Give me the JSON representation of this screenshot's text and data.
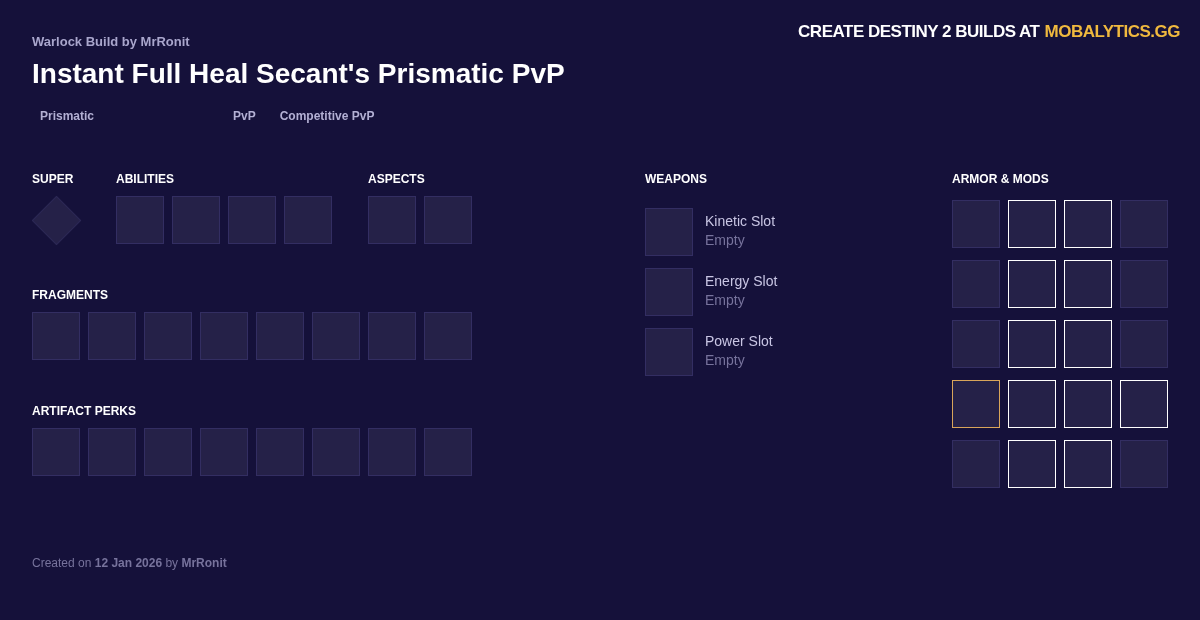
{
  "header": {
    "byline": "Warlock Build by **MrRonit**",
    "title": "Instant Full Heal Secant's Prismatic PvP"
  },
  "banner": {
    "text": "CREATE DESTINY 2 BUILDS AT",
    "link": "MOBALYTICS.GG"
  },
  "tags": [
    {
      "label": "Prismatic",
      "kind": "subclass"
    },
    {
      "label": "PvP",
      "kind": "mode"
    },
    {
      "label": "Competitive PvP",
      "kind": "mode"
    }
  ],
  "top_sections": [
    {
      "title": "SUPER",
      "slots": [
        {
          "kind": "diamond"
        }
      ]
    },
    {
      "title": "ABILITIES",
      "slots": [
        {
          "kind": "square"
        },
        {
          "kind": "square"
        },
        {
          "kind": "square"
        },
        {
          "kind": "square"
        }
      ]
    },
    {
      "title": "ASPECTS",
      "slots": [
        {
          "kind": "square"
        },
        {
          "kind": "square"
        }
      ]
    }
  ],
  "fragments": {
    "title": "FRAGMENTS",
    "slots": [
      {
        "kind": "square"
      },
      {
        "kind": "square"
      },
      {
        "kind": "square"
      },
      {
        "kind": "square"
      },
      {
        "kind": "square"
      },
      {
        "kind": "square"
      },
      {
        "kind": "square"
      },
      {
        "kind": "square"
      }
    ]
  },
  "artifact_perks": {
    "title": "ARTIFACT PERKS",
    "slots": [
      {
        "kind": "square"
      },
      {
        "kind": "square"
      },
      {
        "kind": "square"
      },
      {
        "kind": "square"
      },
      {
        "kind": "square"
      },
      {
        "kind": "square"
      },
      {
        "kind": "square"
      },
      {
        "kind": "square"
      }
    ]
  },
  "weapons": {
    "title": "WEAPONS",
    "items": [
      {
        "name": "Kinetic Slot",
        "status": "Empty"
      },
      {
        "name": "Energy Slot",
        "status": "Empty"
      },
      {
        "name": "Power Slot",
        "status": "Empty"
      }
    ]
  },
  "armor": {
    "title": "ARMOR & MODS",
    "rows": [
      [
        {
          "kind": "square"
        },
        {
          "kind": "outlined"
        },
        {
          "kind": "outlined"
        },
        {
          "kind": "square"
        }
      ],
      [
        {
          "kind": "square"
        },
        {
          "kind": "outlined"
        },
        {
          "kind": "outlined"
        },
        {
          "kind": "square"
        }
      ],
      [
        {
          "kind": "square"
        },
        {
          "kind": "outlined"
        },
        {
          "kind": "outlined"
        },
        {
          "kind": "square"
        }
      ],
      [
        {
          "kind": "exotic"
        },
        {
          "kind": "outlined"
        },
        {
          "kind": "outlined"
        },
        {
          "kind": "outlined"
        }
      ],
      [
        {
          "kind": "square"
        },
        {
          "kind": "outlined"
        },
        {
          "kind": "outlined"
        },
        {
          "kind": "square"
        }
      ]
    ]
  },
  "footer": {
    "text": "Created on **12 Jan 2026** by **MrRonit**"
  }
}
